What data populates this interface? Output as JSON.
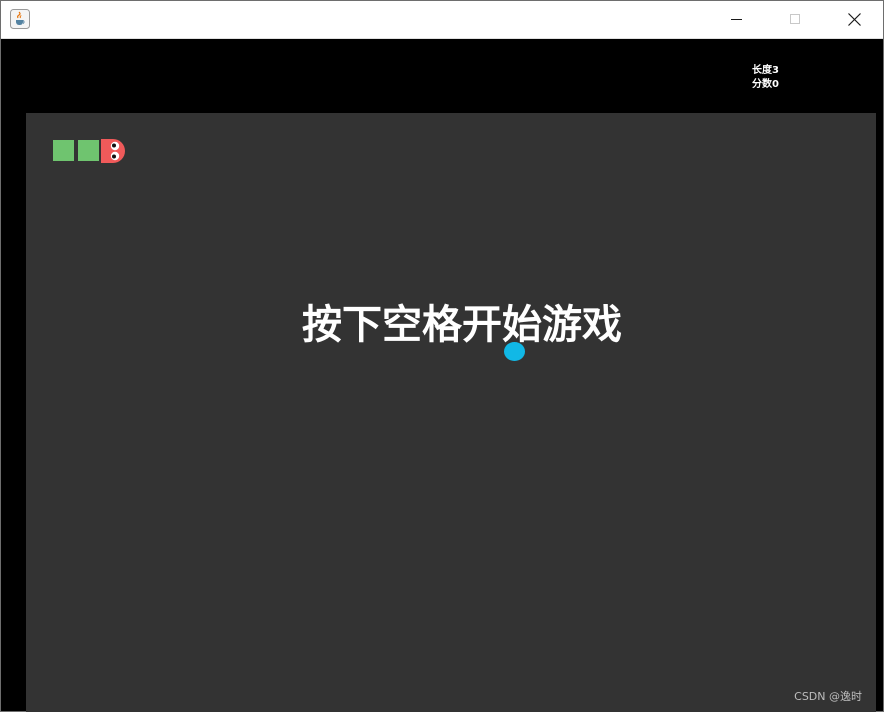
{
  "window": {
    "app_icon": "java-coffee-cup-icon"
  },
  "stats": {
    "length_text": "长度3",
    "score_text": "分数0"
  },
  "game": {
    "start_message": "按下空格开始游戏",
    "snake_length": 3,
    "colors": {
      "board": "#333333",
      "snake_body": "#6fc46f",
      "snake_head": "#f05a5a",
      "food": "#11b8e6",
      "text": "#ffffff"
    }
  },
  "watermark": {
    "text": "CSDN @逸时"
  }
}
